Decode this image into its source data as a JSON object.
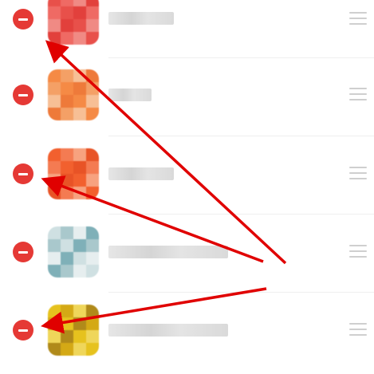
{
  "colors": {
    "remove_button": "#e53935",
    "annotation_arrow": "#e00000",
    "drag_handle": "#cfcfcf",
    "divider": "#efefef"
  },
  "list": {
    "items": [
      {
        "name": "",
        "remove_icon": "minus-circle-icon",
        "handle_icon": "drag-handle-icon",
        "icon_palette": [
          "#e8504a",
          "#ef6a64",
          "#f08a84",
          "#e2403c"
        ]
      },
      {
        "name": "",
        "remove_icon": "minus-circle-icon",
        "handle_icon": "drag-handle-icon",
        "icon_palette": [
          "#f58a45",
          "#f4a066",
          "#f7bf95",
          "#ee7a3a"
        ]
      },
      {
        "name": "",
        "remove_icon": "minus-circle-icon",
        "handle_icon": "drag-handle-icon",
        "icon_palette": [
          "#f2602e",
          "#f47b52",
          "#f7a27f",
          "#e85326"
        ]
      },
      {
        "name": "",
        "remove_icon": "minus-circle-icon",
        "handle_icon": "drag-handle-icon",
        "icon_palette": [
          "#cfe0e2",
          "#a9c8cc",
          "#e6eeef",
          "#7fb0b8"
        ]
      },
      {
        "name": "",
        "remove_icon": "minus-circle-icon",
        "handle_icon": "drag-handle-icon",
        "icon_palette": [
          "#e6c21e",
          "#d4a915",
          "#efd65a",
          "#b08a1a"
        ]
      }
    ]
  },
  "annotations": {
    "arrow_icon": "red-arrow-icon"
  }
}
